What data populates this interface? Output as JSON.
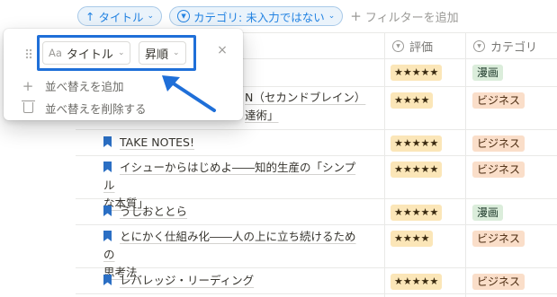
{
  "filter_bar": {
    "sort_pill": {
      "arrow": "↑",
      "label": "タイトル",
      "chevron": "⌄"
    },
    "filter_pill": {
      "label": "カテゴリ: 未入力ではない",
      "chevron": "⌄"
    },
    "add_filter": {
      "plus": "+",
      "label": "フィルターを追加"
    }
  },
  "table": {
    "columns": [
      {
        "label": "評価",
        "icon": "select-circle-icon"
      },
      {
        "label": "カテゴリ",
        "icon": "select-circle-icon"
      }
    ],
    "rows": [
      {
        "title_lines": [
          "",
          ""
        ],
        "rating": "★★★★★",
        "category": "漫画",
        "category_type": "manga"
      },
      {
        "title_lines": [
          "N（セカンドブレイン）",
          "達術」"
        ],
        "rating": "★★★★",
        "category": "ビジネス",
        "category_type": "biz"
      },
      {
        "title_lines": [
          "TAKE NOTES!",
          ""
        ],
        "rating": "★★★★★",
        "category": "ビジネス",
        "category_type": "biz"
      },
      {
        "title_lines": [
          "イシューからはじめよ――知的生産の「シンプル",
          "な本質」"
        ],
        "rating": "★★★★★",
        "category": "ビジネス",
        "category_type": "biz"
      },
      {
        "title_lines": [
          "うしおととら",
          ""
        ],
        "rating": "★★★★★",
        "category": "漫画",
        "category_type": "manga"
      },
      {
        "title_lines": [
          "とにかく仕組み化――人の上に立ち続けるための",
          "思考法"
        ],
        "rating": "★★★★",
        "category": "ビジネス",
        "category_type": "biz"
      },
      {
        "title_lines": [
          "レバレッジ・リーディング",
          ""
        ],
        "rating": "★★★★★",
        "category": "ビジネス",
        "category_type": "biz"
      }
    ]
  },
  "sort_popup": {
    "property_prefix": "Aa",
    "property_label": "タイトル",
    "direction_label": "昇順",
    "close": "×",
    "add_sort": {
      "icon": "+",
      "label": "並べ替えを追加"
    },
    "delete_sort": {
      "label": "並べ替えを削除する"
    }
  },
  "colors": {
    "accent": "#2383e2",
    "highlight_box": "#1f6fd8",
    "stars_bg": "#fbe6b8",
    "tag_manga_bg": "#dbeddb",
    "tag_biz_bg": "#fadec9"
  }
}
